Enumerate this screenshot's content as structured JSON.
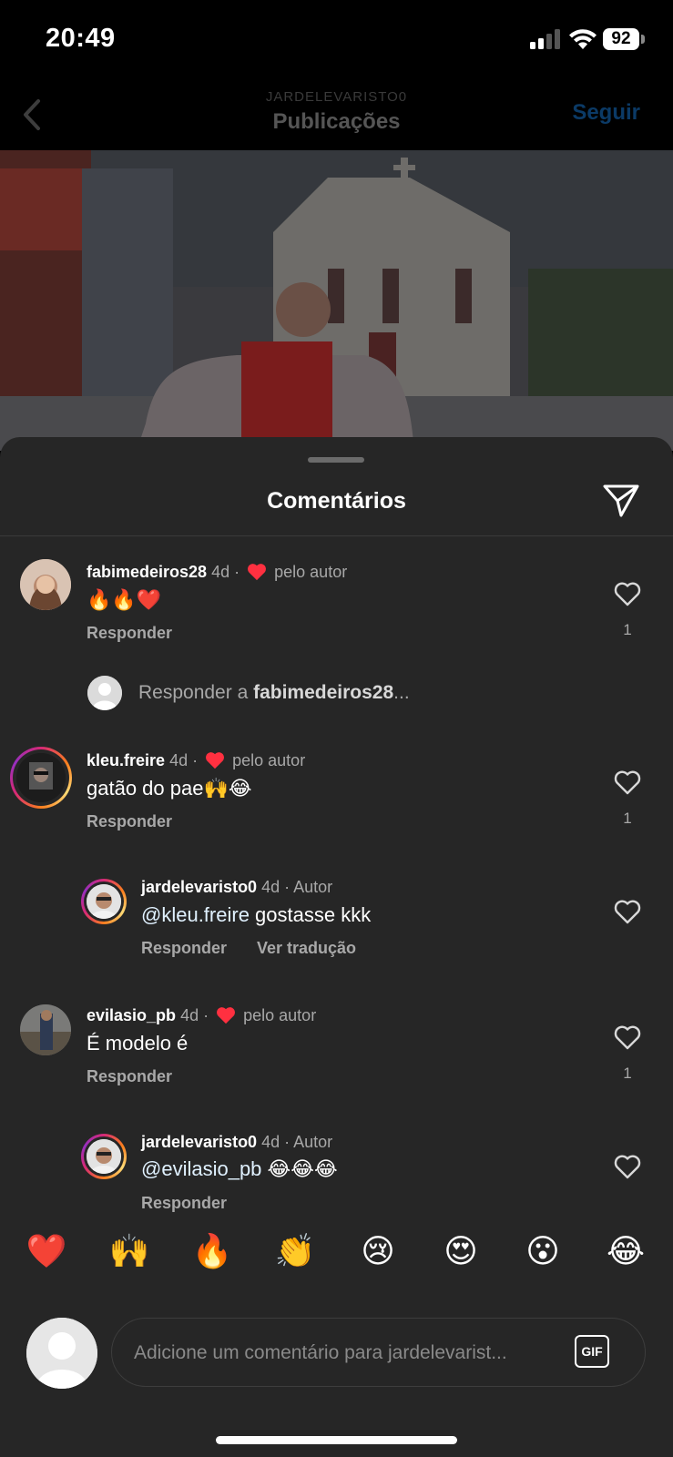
{
  "status_bar": {
    "time": "20:49",
    "battery": "92"
  },
  "header": {
    "username": "JARDELEVARISTO0",
    "title": "Publicações",
    "follow_label": "Seguir"
  },
  "sheet": {
    "title": "Comentários"
  },
  "comments": [
    {
      "username": "fabimedeiros28",
      "time": "4d",
      "liked_by_author": "pelo autor",
      "text": "🔥🔥❤️",
      "reply_label": "Responder",
      "likes": "1"
    },
    {
      "username": "kleu.freire",
      "time": "4d",
      "liked_by_author": "pelo autor",
      "text": "gatão do pae🙌😂",
      "reply_label": "Responder",
      "likes": "1"
    },
    {
      "username": "jardelevaristo0",
      "time": "4d",
      "author_tag": "Autor",
      "mention": "@kleu.freire",
      "text": " gostasse kkk",
      "reply_label": "Responder",
      "translate_label": "Ver tradução"
    },
    {
      "username": "evilasio_pb",
      "time": "4d",
      "liked_by_author": "pelo autor",
      "text": "É modelo é",
      "reply_label": "Responder",
      "likes": "1"
    },
    {
      "username": "jardelevaristo0",
      "time": "4d",
      "author_tag": "Autor",
      "mention": "@evilasio_pb",
      "text": " 😂😂😂",
      "reply_label": "Responder"
    }
  ],
  "reply_prompt": {
    "prefix": "Responder a ",
    "username": "fabimedeiros28",
    "suffix": "..."
  },
  "emoji_bar": [
    "❤️",
    "🙌",
    "🔥",
    "👏",
    "😢",
    "😍",
    "😮",
    "😂"
  ],
  "composer": {
    "placeholder": "Adicione um comentário para jardelevarist...",
    "gif_label": "GIF"
  },
  "colors": {
    "sheet_bg": "#262626",
    "like_red": "#ff3040",
    "follow_blue": "#0b3a66"
  }
}
